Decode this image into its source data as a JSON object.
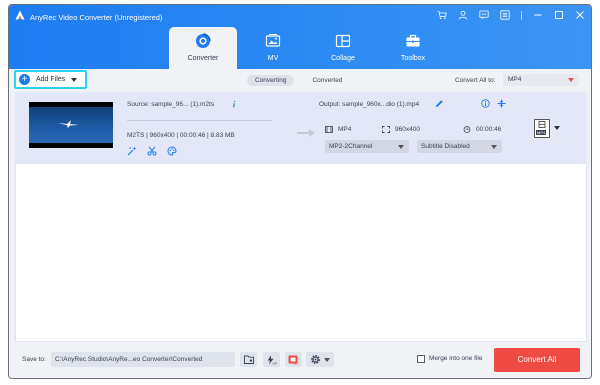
{
  "window": {
    "title": "AnyRec Video Converter (Unregistered)",
    "controls": [
      "cart-icon",
      "user-icon",
      "feedback-icon",
      "menu-icon",
      "minimize-icon",
      "maximize-icon",
      "close-icon"
    ]
  },
  "tabs": [
    {
      "label": "Converter",
      "icon": "converter-icon",
      "active": true
    },
    {
      "label": "MV",
      "icon": "mv-icon",
      "active": false
    },
    {
      "label": "Collage",
      "icon": "collage-icon",
      "active": false
    },
    {
      "label": "Toolbox",
      "icon": "toolbox-icon",
      "active": false
    }
  ],
  "toolbar": {
    "add_files_label": "Add Files",
    "segments": [
      "Converting",
      "Converted"
    ],
    "convert_all_to_label": "Convert All to:",
    "convert_all_format": "MP4"
  },
  "file": {
    "source_name": "Source: sample_96... (1).m2ts",
    "source_format": "M2TS",
    "source_resolution": "960x400",
    "source_duration": "00:00:46",
    "source_size": "8.83 MB",
    "output_name": "Output: sample_960x...dio (1).mp4",
    "output_format": "MP4",
    "output_resolution": "960x400",
    "output_duration": "00:00:46",
    "audio_track": "MP2-2Channel",
    "subtitle": "Subtitle Disabled",
    "format_thumb_label": "MP4"
  },
  "footer": {
    "save_to_label": "Save to:",
    "save_path": "C:\\AnyRec Studio\\AnyRe...eo Converter\\Converted",
    "merge_label": "Merge into one file",
    "merge_checked": false,
    "convert_all_label": "Convert All"
  },
  "colors": {
    "accent": "#1d7cf2",
    "convert_button": "#ee4b44",
    "highlight_border": "#29d3ef"
  }
}
